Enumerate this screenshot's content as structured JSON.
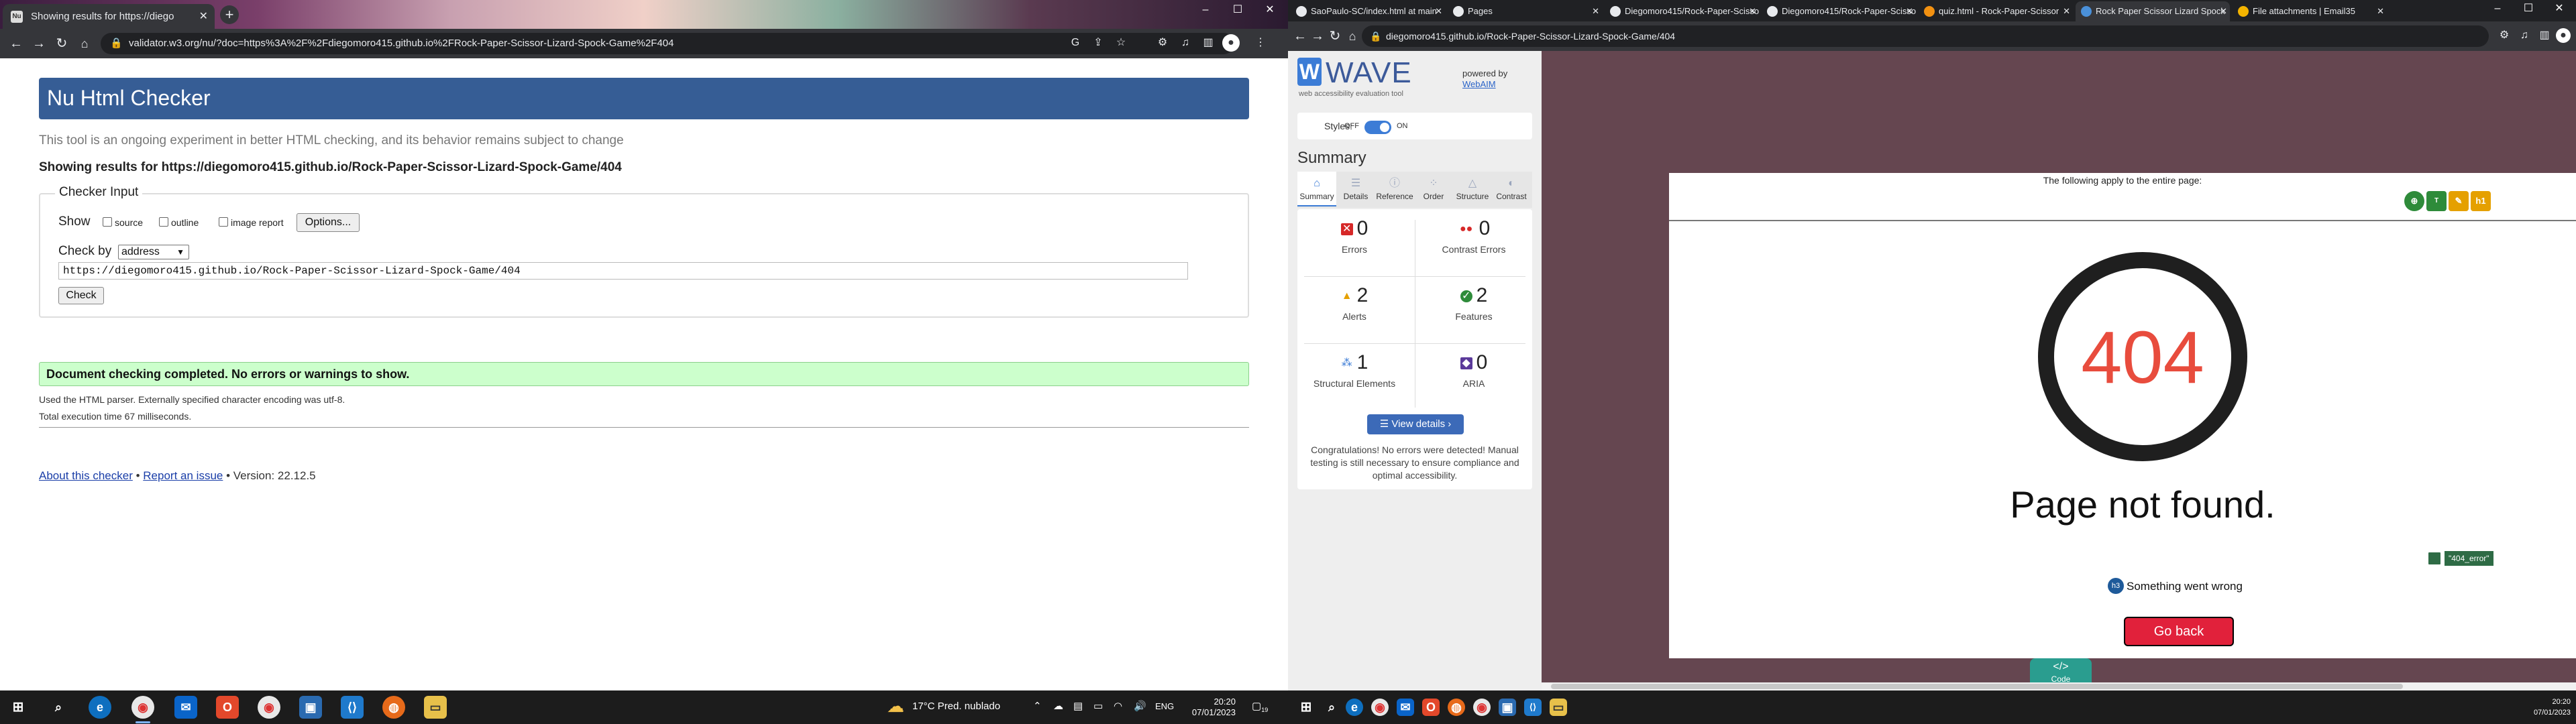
{
  "left_browser": {
    "tab_title": "Showing results for https://diego",
    "tab_favicon": "Nu",
    "url": "validator.w3.org/nu/?doc=https%3A%2F%2Fdiegomoro415.github.io%2FRock-Paper-Scissor-Lizard-Spock-Game%2F404"
  },
  "nu_checker": {
    "title": "Nu Html Checker",
    "subtitle": "This tool is an ongoing experiment in better HTML checking, and its behavior remains subject to change",
    "showing_results": "Showing results for https://diegomoro415.github.io/Rock-Paper-Scissor-Lizard-Spock-Game/404",
    "checker_input_legend": "Checker Input",
    "show_label": "Show",
    "opt_source": "source",
    "opt_outline": "outline",
    "opt_image_report": "image report",
    "options_button": "Options...",
    "check_by_label": "Check by",
    "check_by_value": "address",
    "address_value": "https://diegomoro415.github.io/Rock-Paper-Scissor-Lizard-Spock-Game/404",
    "check_button": "Check",
    "success_message": "Document checking completed. No errors or warnings to show.",
    "parser_info": "Used the HTML parser. Externally specified character encoding was utf-8.",
    "exec_time": "Total execution time 67 milliseconds.",
    "footer_about": "About this checker",
    "footer_sep1": "•",
    "footer_report": "Report an issue",
    "footer_version": "• Version: 22.12.5"
  },
  "right_browser": {
    "tabs": [
      {
        "label": "SaoPaulo-SC/index.html at main"
      },
      {
        "label": "Pages"
      },
      {
        "label": "Diegomoro415/Rock-Paper-Scissor"
      },
      {
        "label": "Diegomoro415/Rock-Paper-Scissor"
      },
      {
        "label": "quiz.html - Rock-Paper-Scissor"
      },
      {
        "label": "Rock Paper Scissor Lizard Spock"
      },
      {
        "label": "File attachments | Email35"
      }
    ],
    "url": "diegomoro415.github.io/Rock-Paper-Scissor-Lizard-Spock-Game/404"
  },
  "wave": {
    "logo_letter": "W",
    "logo_word": "WAVE",
    "tagline": "web accessibility evaluation tool",
    "powered_by": "powered by",
    "webaim": "WebAIM",
    "styles_label": "Styles:",
    "styles_off": "OFF",
    "styles_on": "ON",
    "summary_heading": "Summary",
    "tabs": [
      {
        "label": "Summary",
        "icon": "home-icon"
      },
      {
        "label": "Details",
        "icon": "list-icon"
      },
      {
        "label": "Reference",
        "icon": "info-icon"
      },
      {
        "label": "Order",
        "icon": "order-icon"
      },
      {
        "label": "Structure",
        "icon": "structure-icon"
      },
      {
        "label": "Contrast",
        "icon": "contrast-icon"
      }
    ],
    "stats": {
      "errors": {
        "value": "0",
        "label": "Errors"
      },
      "contrast_errors": {
        "value": "0",
        "label": "Contrast Errors"
      },
      "alerts": {
        "value": "2",
        "label": "Alerts"
      },
      "features": {
        "value": "2",
        "label": "Features"
      },
      "structural": {
        "value": "1",
        "label": "Structural Elements"
      },
      "aria": {
        "value": "0",
        "label": "ARIA"
      }
    },
    "view_details": "View details ›",
    "congrats": "Congratulations! No errors were detected! Manual testing is still necessary to ensure compliance and optimal accessibility."
  },
  "page404": {
    "applies_text": "The following apply to the entire page:",
    "code": "404",
    "message": "Page not found.",
    "h3_badge": "h3",
    "h1_badge": "h1",
    "something_wrong": "Something went wrong",
    "go_back": "Go back",
    "error_label": "\"404_error\"",
    "code_button": "</>",
    "code_label": "Code"
  },
  "taskbar": {
    "weather": "17°C  Pred. nublado",
    "lang": "ENG",
    "time_left": "20:20",
    "date_left": "07/01/2023",
    "time_right": "20:20",
    "date_right": "07/01/2023",
    "notif_count": "19"
  },
  "colors": {
    "nu_header": "#365d95",
    "success_bg": "#ccffcc",
    "wave_blue": "#3c7cd6",
    "page_bg": "#654650",
    "error_red": "#e84c3d",
    "go_back_red": "#e1213b"
  }
}
